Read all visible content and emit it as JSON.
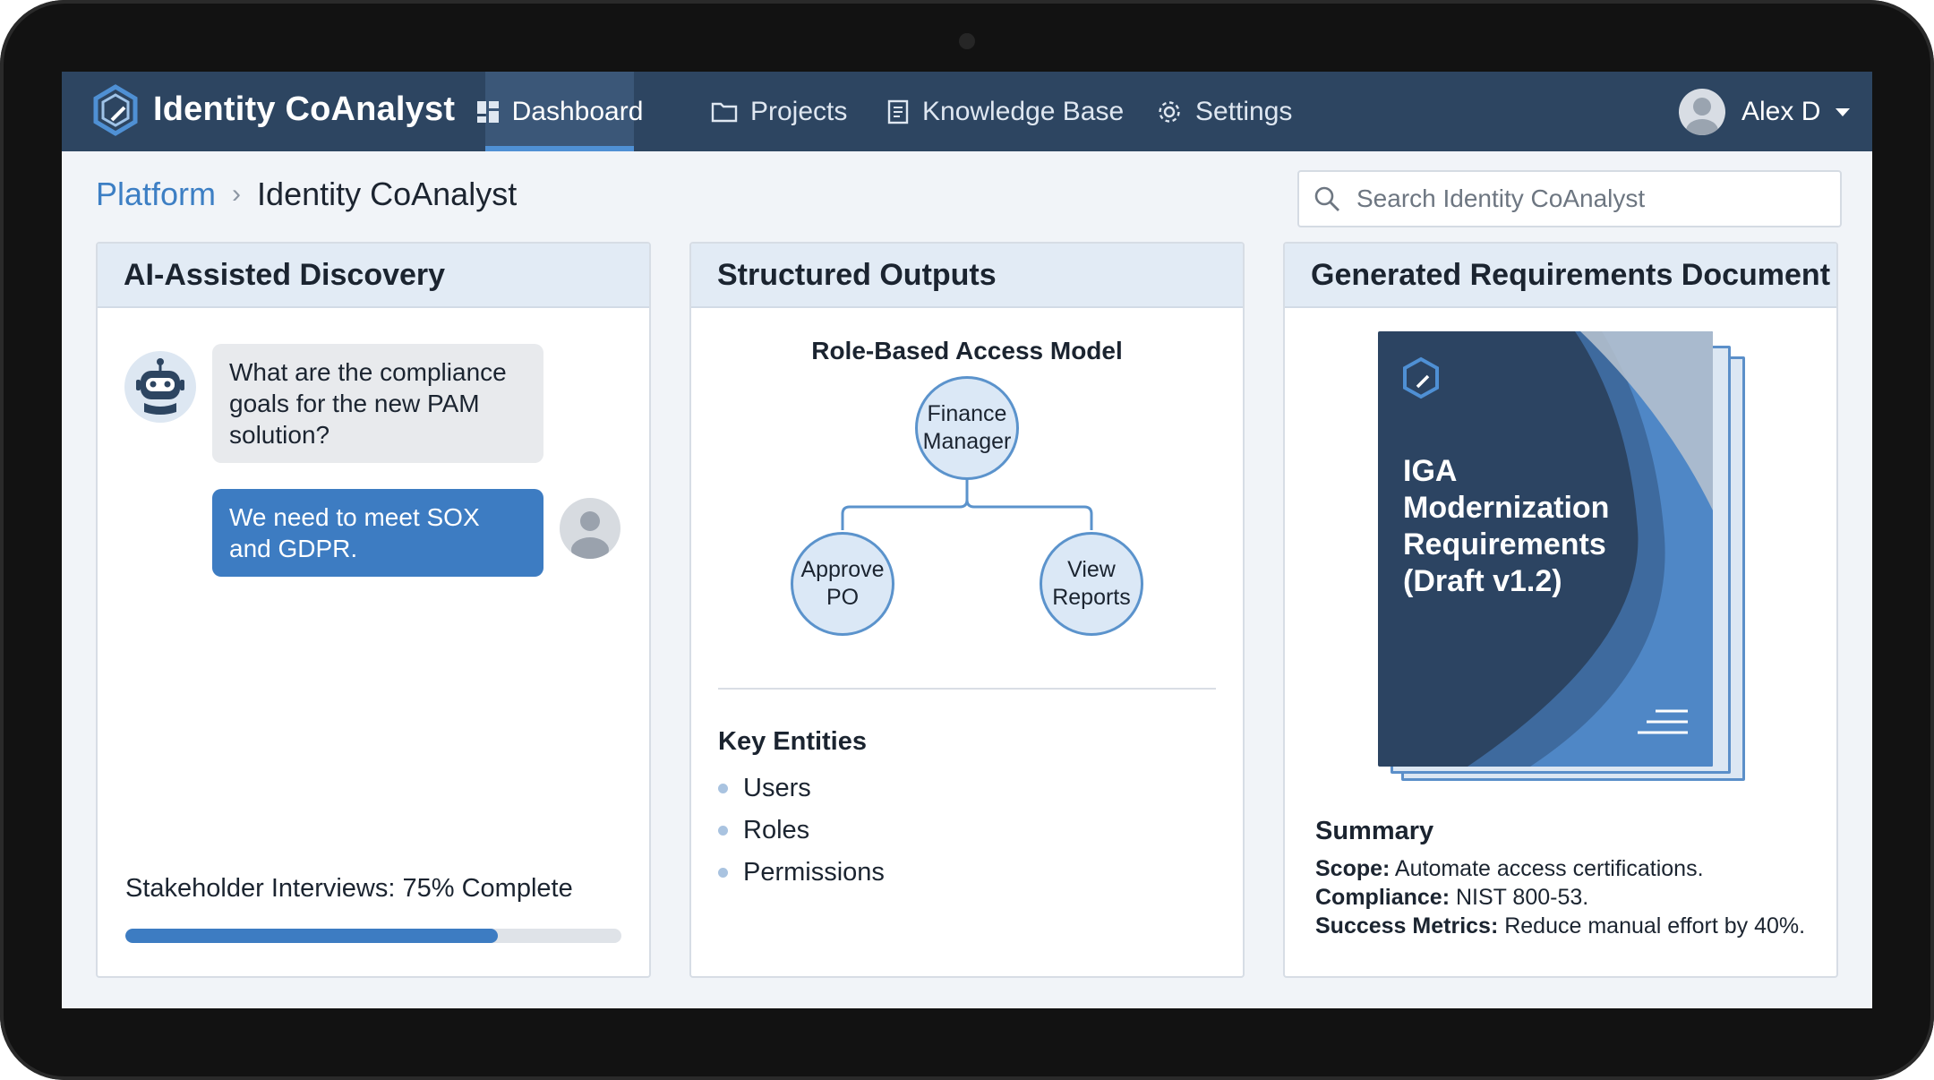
{
  "app": {
    "title": "Identity CoAnalyst"
  },
  "nav": {
    "items": [
      {
        "label": "Dashboard",
        "icon": "dashboard-grid-icon",
        "active": true
      },
      {
        "label": "Projects",
        "icon": "folder-icon",
        "active": false
      },
      {
        "label": "Knowledge Base",
        "icon": "book-icon",
        "active": false
      },
      {
        "label": "Settings",
        "icon": "gear-icon",
        "active": false
      }
    ],
    "user": {
      "name": "Alex D"
    }
  },
  "breadcrumb": {
    "parent": "Platform",
    "separator": "›",
    "current": "Identity CoAnalyst"
  },
  "search": {
    "placeholder": "Search Identity CoAnalyst",
    "value": ""
  },
  "discovery": {
    "title": "AI-Assisted Discovery",
    "messages": [
      {
        "from": "bot",
        "text": "What are the compliance goals for the new PAM solution?"
      },
      {
        "from": "user",
        "text": "We need to meet SOX and GDPR."
      }
    ],
    "progress": {
      "label": "Stakeholder Interviews: 75% Complete",
      "percent": 75
    }
  },
  "outputs": {
    "title": "Structured Outputs",
    "model": {
      "title": "Role-Based Access Model",
      "root": "Finance\nManager",
      "children": [
        "Approve\nPO",
        "View\nReports"
      ]
    },
    "entities": {
      "title": "Key Entities",
      "items": [
        "Users",
        "Roles",
        "Permissions"
      ]
    }
  },
  "document": {
    "title": "Generated Requirements Document",
    "cover_title": "IGA\nModernization\nRequirements\n(Draft v1.2)",
    "summary": {
      "title": "Summary",
      "lines": [
        {
          "key": "Scope:",
          "value": " Automate access certifications."
        },
        {
          "key": "Compliance:",
          "value": " NIST 800-53."
        },
        {
          "key": "Success Metrics:",
          "value": " Reduce manual effort by 40%."
        }
      ]
    }
  },
  "colors": {
    "nav_bg": "#2d4561",
    "accent": "#3d7cc2",
    "link": "#3d7fc4",
    "panel_header": "#e2ebf5"
  }
}
